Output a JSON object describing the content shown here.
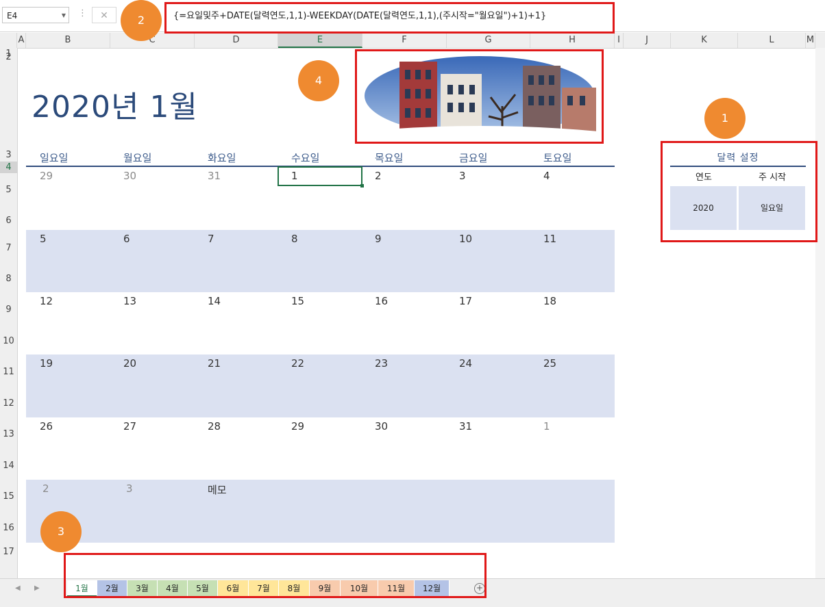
{
  "name_box": "E4",
  "formula": "{=요일및주+DATE(달력연도,1,1)-WEEKDAY(DATE(달력연도,1,1),(주시작=\"월요일\")+1)+1}",
  "columns": [
    "A",
    "B",
    "C",
    "D",
    "E",
    "F",
    "G",
    "H",
    "I",
    "J",
    "K",
    "L",
    "M"
  ],
  "rows": [
    "1",
    "2",
    "3",
    "4",
    "5",
    "6",
    "7",
    "8",
    "9",
    "10",
    "11",
    "12",
    "13",
    "14",
    "15",
    "16",
    "17"
  ],
  "calendar": {
    "title": "2020년 1월",
    "weekdays": [
      "일요일",
      "월요일",
      "화요일",
      "수요일",
      "목요일",
      "금요일",
      "토요일"
    ],
    "weeks": [
      [
        "29",
        "30",
        "31",
        "1",
        "2",
        "3",
        "4"
      ],
      [
        "5",
        "6",
        "7",
        "8",
        "9",
        "10",
        "11"
      ],
      [
        "12",
        "13",
        "14",
        "15",
        "16",
        "17",
        "18"
      ],
      [
        "19",
        "20",
        "21",
        "22",
        "23",
        "24",
        "25"
      ],
      [
        "26",
        "27",
        "28",
        "29",
        "30",
        "31",
        "1"
      ],
      [
        "2",
        "3"
      ]
    ],
    "memo_label": "메모"
  },
  "settings": {
    "title": "달력 설정",
    "year_label": "연도",
    "week_start_label": "주 시작",
    "year_value": "2020",
    "week_start_value": "일요일"
  },
  "sheet_tabs": [
    {
      "label": "1월",
      "color": "#ffffff"
    },
    {
      "label": "2월",
      "color": "#b4c3e6"
    },
    {
      "label": "3월",
      "color": "#c6e0b4"
    },
    {
      "label": "4월",
      "color": "#c6e0b4"
    },
    {
      "label": "5월",
      "color": "#c6e0b4"
    },
    {
      "label": "6월",
      "color": "#ffe699"
    },
    {
      "label": "7월",
      "color": "#ffe699"
    },
    {
      "label": "8월",
      "color": "#ffe699"
    },
    {
      "label": "9월",
      "color": "#f8cbad"
    },
    {
      "label": "10월",
      "color": "#f8cbad"
    },
    {
      "label": "11월",
      "color": "#f8cbad"
    },
    {
      "label": "12월",
      "color": "#b4c3e6"
    }
  ],
  "annotations": [
    "1",
    "2",
    "3",
    "4"
  ],
  "accent_color": "#217346",
  "highlight_color": "#e01818",
  "badge_color": "#ef8a30"
}
